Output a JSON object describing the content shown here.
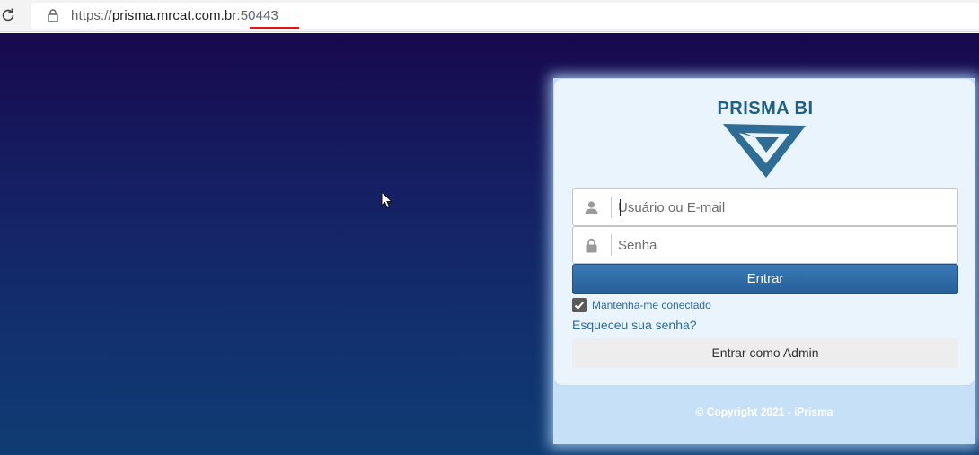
{
  "browser": {
    "url_scheme": "https://",
    "url_host": "prisma.mrcat.com.br",
    "url_port": ":50443"
  },
  "login": {
    "brand": "PRISMA BI",
    "username_placeholder": "Usuário ou E-mail",
    "password_placeholder": "Senha",
    "login_button": "Entrar",
    "remember_label": "Mantenha-me conectado",
    "remember_checked": true,
    "forgot_link": "Esqueceu sua senha?",
    "admin_button": "Entrar como Admin"
  },
  "footer": {
    "copyright": "© Copyright 2021 - iPrisma"
  },
  "colors": {
    "brand": "#1f5f85",
    "primary_button": "#2d6aa6",
    "link": "#2c6aa0",
    "background_top": "#18084e",
    "background_bottom": "#0f3c73"
  },
  "icons": [
    "reload-icon",
    "lock-icon",
    "user-icon",
    "padlock-icon",
    "checkbox-checked-icon",
    "cursor-icon"
  ]
}
